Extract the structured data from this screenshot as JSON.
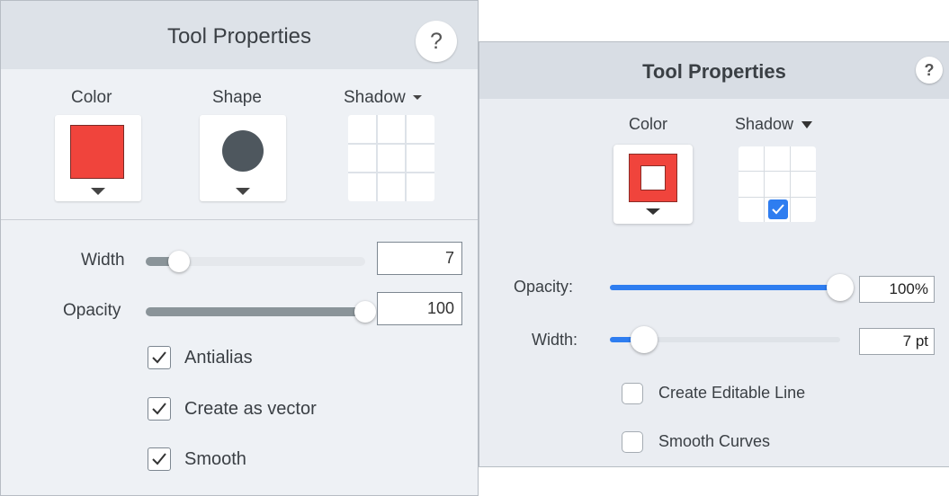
{
  "left_panel": {
    "title": "Tool Properties",
    "help": "?",
    "color_label": "Color",
    "color_value": "#f0443c",
    "shape_label": "Shape",
    "shape_icon": "circle",
    "shadow_label": "Shadow",
    "width_label": "Width",
    "width_value": "7",
    "width_level": 0.15,
    "opacity_label": "Opacity",
    "opacity_value": "100",
    "opacity_level": 1.0,
    "antialias_label": "Antialias",
    "antialias_checked": true,
    "vector_label": "Create as vector",
    "vector_checked": true,
    "smooth_label": "Smooth",
    "smooth_checked": true
  },
  "right_panel": {
    "title": "Tool Properties",
    "help": "?",
    "color_label": "Color",
    "color_value": "#f0443c",
    "shadow_label": "Shadow",
    "shadow_selected": "bottom-center",
    "opacity_label": "Opacity:",
    "opacity_value": "100%",
    "opacity_level": 1.0,
    "width_label": "Width:",
    "width_value": "7 pt",
    "width_level": 0.15,
    "editable_line_label": "Create Editable Line",
    "editable_line_checked": false,
    "smooth_curves_label": "Smooth Curves",
    "smooth_curves_checked": false
  },
  "colors": {
    "accent": "#2e7df0",
    "swatch_red": "#f0443c",
    "shape_gray": "#4e575e"
  }
}
